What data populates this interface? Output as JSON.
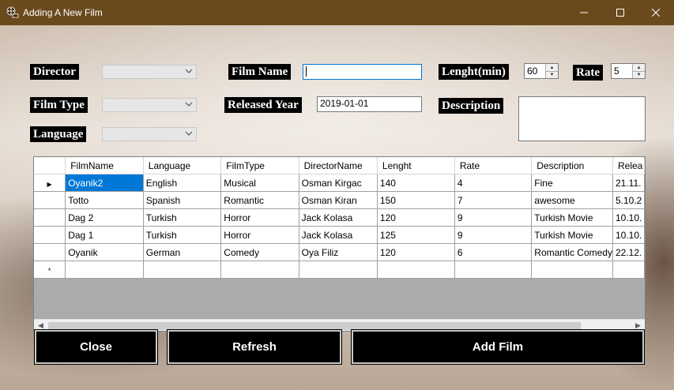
{
  "window": {
    "title": "Adding A New Film",
    "minimize_glyph": "—",
    "maximize_glyph": "☐",
    "close_glyph": "✕"
  },
  "form": {
    "director_label": "Director",
    "film_type_label": "Film Type",
    "language_label": "Language",
    "film_name_label": "Film Name",
    "released_year_label": "Released Year",
    "length_label": "Lenght(min)",
    "rate_label": "Rate",
    "description_label": "Description",
    "film_name_value": "",
    "released_year_value": "2019-01-01",
    "length_value": "60",
    "rate_value": "5",
    "description_value": ""
  },
  "grid": {
    "columns": [
      "FilmName",
      "Language",
      "FilmType",
      "DirectorName",
      "Lenght",
      "Rate",
      "Description",
      "Relea"
    ],
    "rows": [
      [
        "Oyanik2",
        "English",
        "Musical",
        "Osman Kirgac",
        "140",
        "4",
        "Fine",
        "21.11."
      ],
      [
        "Totto",
        "Spanish",
        "Romantic",
        "Osman Kiran",
        "150",
        "7",
        "awesome",
        "5.10.2"
      ],
      [
        "Dag 2",
        "Turkish",
        "Horror",
        "Jack Kolasa",
        "120",
        "9",
        "Turkish Movie",
        "10.10."
      ],
      [
        "Dag 1",
        "Turkish",
        "Horror",
        "Jack Kolasa",
        "125",
        "9",
        "Turkish Movie",
        "10.10."
      ],
      [
        "Oyanik",
        "German",
        "Comedy",
        "Oya Filiz",
        "120",
        "6",
        "Romantic Comedy",
        "22.12."
      ]
    ],
    "current_row_marker": "▶",
    "new_row_marker": "*"
  },
  "buttons": {
    "close": "Close",
    "refresh": "Refresh",
    "add_film": "Add Film"
  }
}
